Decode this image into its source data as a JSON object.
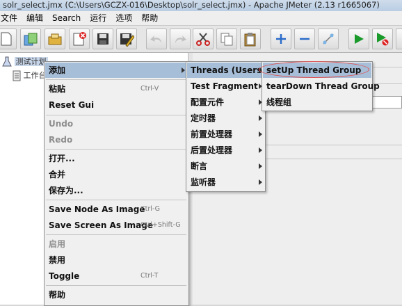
{
  "window": {
    "title": "solr_select.jmx (C:\\Users\\GCZX-016\\Desktop\\solr_select.jmx) - Apache JMeter (2.13 r1665067)"
  },
  "menubar": [
    "文件",
    "编辑",
    "Search",
    "运行",
    "选项",
    "帮助"
  ],
  "toolbar": [
    "new-icon",
    "templates-icon",
    "open-icon",
    "close-icon",
    "save-icon",
    "save-as-icon",
    "undo-icon",
    "redo-icon",
    "cut-icon",
    "copy-icon",
    "paste-icon",
    "expand-icon",
    "collapse-icon",
    "toggle-icon",
    "start-icon",
    "start-no-pause-icon"
  ],
  "tree": {
    "test_plan": "测试计划",
    "workbench": "工作台"
  },
  "context_menu": {
    "add": "添加",
    "paste": "粘贴",
    "paste_shortcut": "Ctrl-V",
    "reset_gui": "Reset Gui",
    "undo": "Undo",
    "redo": "Redo",
    "open": "打开...",
    "merge": "合并",
    "save_as": "保存为...",
    "save_node_as_image": "Save Node As Image",
    "save_node_shortcut": "Ctrl-G",
    "save_screen_as_image": "Save Screen As Image",
    "save_screen_shortcut": "Ctrl+Shift-G",
    "enable": "启用",
    "disable": "禁用",
    "toggle": "Toggle",
    "toggle_shortcut": "Ctrl-T",
    "help": "帮助"
  },
  "add_submenu": {
    "threads": "Threads (Users)",
    "test_fragment": "Test Fragment",
    "config": "配置元件",
    "timer": "定时器",
    "pre_processor": "前置处理器",
    "post_processor": "后置处理器",
    "assertion": "断言",
    "listener": "监听器"
  },
  "threads_submenu": {
    "setup_thread_group": "setUp Thread Group",
    "teardown_thread_group": "tearDown Thread Group",
    "thread_group": "线程组"
  },
  "colors": {
    "selection": "#a7bed8",
    "highlight_oval": "#e05050"
  }
}
